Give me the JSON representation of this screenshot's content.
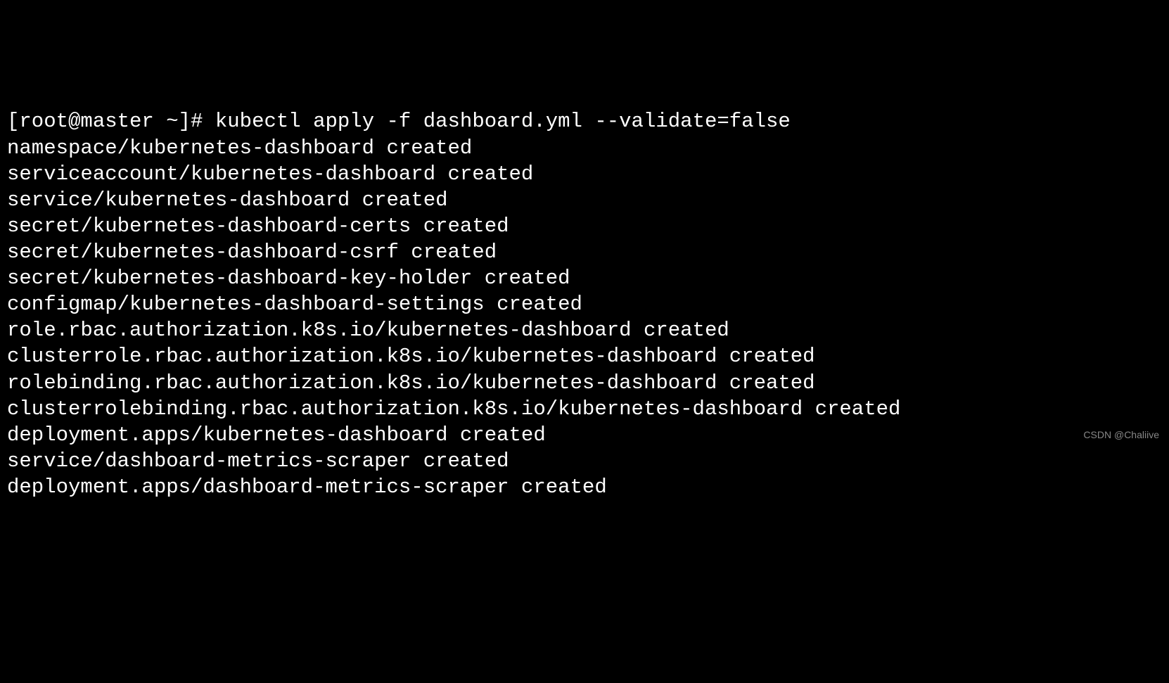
{
  "terminal": {
    "prompt": "[root@master ~]# ",
    "command": "kubectl apply -f dashboard.yml --validate=false",
    "output": [
      "namespace/kubernetes-dashboard created",
      "serviceaccount/kubernetes-dashboard created",
      "service/kubernetes-dashboard created",
      "secret/kubernetes-dashboard-certs created",
      "secret/kubernetes-dashboard-csrf created",
      "secret/kubernetes-dashboard-key-holder created",
      "configmap/kubernetes-dashboard-settings created",
      "role.rbac.authorization.k8s.io/kubernetes-dashboard created",
      "clusterrole.rbac.authorization.k8s.io/kubernetes-dashboard created",
      "rolebinding.rbac.authorization.k8s.io/kubernetes-dashboard created",
      "clusterrolebinding.rbac.authorization.k8s.io/kubernetes-dashboard created",
      "deployment.apps/kubernetes-dashboard created",
      "service/dashboard-metrics-scraper created",
      "deployment.apps/dashboard-metrics-scraper created"
    ]
  },
  "watermark": "CSDN @Chaliive"
}
